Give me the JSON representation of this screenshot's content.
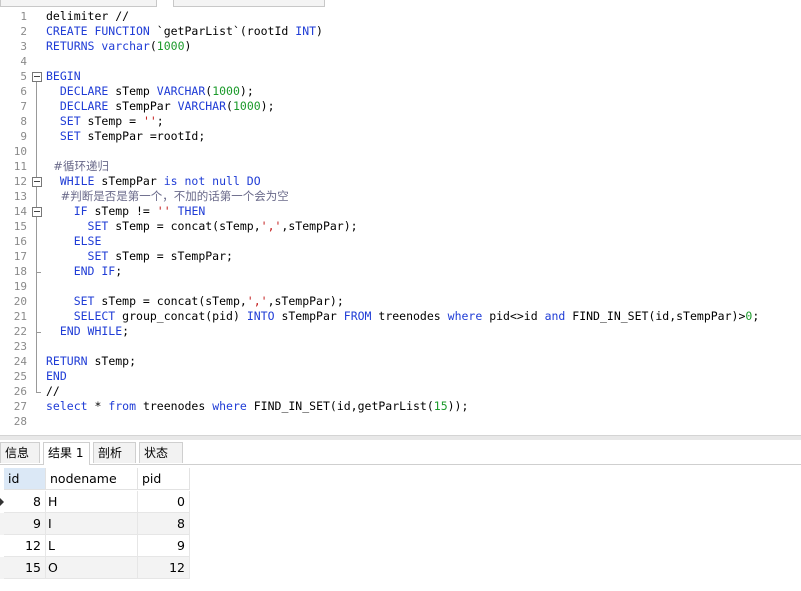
{
  "editor": {
    "lines": [
      {
        "n": "1",
        "parts": [
          [
            "delimiter //",
            ""
          ]
        ]
      },
      {
        "n": "2",
        "parts": [
          [
            "CREATE FUNCTION",
            "kw"
          ],
          [
            " `getParList`(rootId ",
            ""
          ],
          [
            "INT",
            "kw"
          ],
          [
            ")",
            ""
          ]
        ]
      },
      {
        "n": "3",
        "parts": [
          [
            "RETURNS varchar",
            "kw"
          ],
          [
            "(",
            ""
          ],
          [
            "1000",
            "num"
          ],
          [
            ")",
            ""
          ]
        ]
      },
      {
        "n": "4",
        "parts": []
      },
      {
        "n": "5",
        "parts": [
          [
            "BEGIN",
            "kw"
          ]
        ]
      },
      {
        "n": "6",
        "parts": [
          [
            "  DECLARE",
            "kw"
          ],
          [
            " sTemp ",
            ""
          ],
          [
            "VARCHAR",
            "kw"
          ],
          [
            "(",
            ""
          ],
          [
            "1000",
            "num"
          ],
          [
            ");",
            ""
          ]
        ]
      },
      {
        "n": "7",
        "parts": [
          [
            "  DECLARE",
            "kw"
          ],
          [
            " sTempPar ",
            ""
          ],
          [
            "VARCHAR",
            "kw"
          ],
          [
            "(",
            ""
          ],
          [
            "1000",
            "num"
          ],
          [
            ");",
            ""
          ]
        ]
      },
      {
        "n": "8",
        "parts": [
          [
            "  SET",
            "kw"
          ],
          [
            " sTemp = ",
            ""
          ],
          [
            "''",
            "str"
          ],
          [
            ";",
            ""
          ]
        ]
      },
      {
        "n": "9",
        "parts": [
          [
            "  SET",
            "kw"
          ],
          [
            " sTempPar =rootId;",
            ""
          ]
        ]
      },
      {
        "n": "10",
        "parts": []
      },
      {
        "n": "11",
        "parts": [
          [
            "  #循环递归",
            "cmt"
          ]
        ]
      },
      {
        "n": "12",
        "parts": [
          [
            "  WHILE",
            "kw"
          ],
          [
            " sTempPar ",
            ""
          ],
          [
            "is not null DO",
            "kw"
          ]
        ]
      },
      {
        "n": "13",
        "parts": [
          [
            "    #判断是否是第一个，不加的话第一个会为空",
            "cmt"
          ]
        ]
      },
      {
        "n": "14",
        "parts": [
          [
            "    IF",
            "kw"
          ],
          [
            " sTemp != ",
            ""
          ],
          [
            "''",
            "str"
          ],
          [
            " ",
            ""
          ],
          [
            "THEN",
            "kw"
          ]
        ]
      },
      {
        "n": "15",
        "parts": [
          [
            "      SET",
            "kw"
          ],
          [
            " sTemp = concat(sTemp,",
            ""
          ],
          [
            "','",
            "str"
          ],
          [
            ",sTempPar);",
            ""
          ]
        ]
      },
      {
        "n": "16",
        "parts": [
          [
            "    ELSE",
            "kw"
          ]
        ]
      },
      {
        "n": "17",
        "parts": [
          [
            "      SET",
            "kw"
          ],
          [
            " sTemp = sTempPar;",
            ""
          ]
        ]
      },
      {
        "n": "18",
        "parts": [
          [
            "    END IF",
            "kw"
          ],
          [
            ";",
            ""
          ]
        ]
      },
      {
        "n": "19",
        "parts": []
      },
      {
        "n": "20",
        "parts": [
          [
            "    SET",
            "kw"
          ],
          [
            " sTemp = concat(sTemp,",
            ""
          ],
          [
            "','",
            "str"
          ],
          [
            ",sTempPar);",
            ""
          ]
        ]
      },
      {
        "n": "21",
        "parts": [
          [
            "    SELECT",
            "kw"
          ],
          [
            " group_concat(pid) ",
            ""
          ],
          [
            "INTO",
            "kw"
          ],
          [
            " sTempPar ",
            ""
          ],
          [
            "FROM",
            "kw"
          ],
          [
            " treenodes ",
            ""
          ],
          [
            "where",
            "kw"
          ],
          [
            " pid<>id ",
            ""
          ],
          [
            "and",
            "kw"
          ],
          [
            " FIND_IN_SET(id,sTempPar)>",
            ""
          ],
          [
            "0",
            "num"
          ],
          [
            ";",
            ""
          ]
        ]
      },
      {
        "n": "22",
        "parts": [
          [
            "  END WHILE",
            "kw"
          ],
          [
            ";",
            ""
          ]
        ]
      },
      {
        "n": "23",
        "parts": []
      },
      {
        "n": "24",
        "parts": [
          [
            "RETURN",
            "kw"
          ],
          [
            " sTemp;",
            ""
          ]
        ]
      },
      {
        "n": "25",
        "parts": [
          [
            "END",
            "kw"
          ]
        ]
      },
      {
        "n": "26",
        "parts": [
          [
            "//",
            ""
          ]
        ]
      },
      {
        "n": "27",
        "parts": [
          [
            "select",
            "kw"
          ],
          [
            " * ",
            ""
          ],
          [
            "from",
            "kw"
          ],
          [
            " treenodes ",
            ""
          ],
          [
            "where",
            "kw"
          ],
          [
            " FIND_IN_SET(id,getParList(",
            ""
          ],
          [
            "15",
            "num"
          ],
          [
            "));",
            ""
          ]
        ]
      },
      {
        "n": "28",
        "parts": []
      }
    ]
  },
  "result_tabs": [
    {
      "label": "信息",
      "active": false
    },
    {
      "label": "结果 1",
      "active": true
    },
    {
      "label": "剖析",
      "active": false
    },
    {
      "label": "状态",
      "active": false
    }
  ],
  "grid": {
    "columns": [
      "id",
      "nodename",
      "pid"
    ],
    "rows": [
      [
        "8",
        "H",
        "0"
      ],
      [
        "9",
        "I",
        "8"
      ],
      [
        "12",
        "L",
        "9"
      ],
      [
        "15",
        "O",
        "12"
      ]
    ]
  },
  "colors": {
    "keyword": "#1f3cd6",
    "number": "#1b9a2a",
    "string": "#c21a1a",
    "comment": "#6a6a8a"
  }
}
